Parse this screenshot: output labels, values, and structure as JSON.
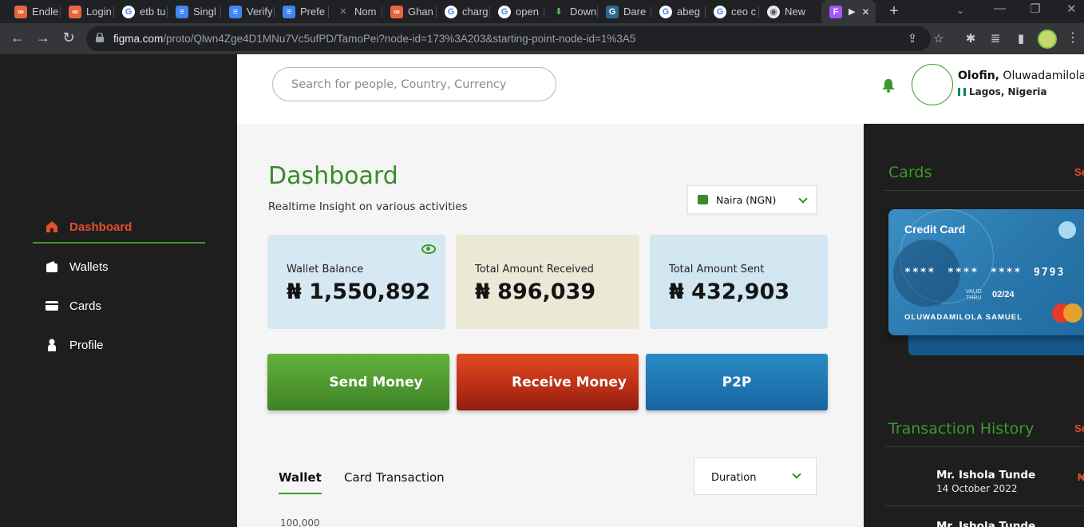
{
  "browser": {
    "tabs": [
      {
        "label": "Endle",
        "icon": "figma-logo-icon",
        "color": "#e8643a"
      },
      {
        "label": "Login",
        "icon": "figma-logo-icon",
        "color": "#e8643a"
      },
      {
        "label": "etb tu",
        "icon": "google-icon",
        "color": "#4285f4"
      },
      {
        "label": "Singl",
        "icon": "docs-icon",
        "color": "#4285f4"
      },
      {
        "label": "Verify",
        "icon": "docs-icon",
        "color": "#4285f4"
      },
      {
        "label": "Prefe",
        "icon": "docs-icon",
        "color": "#4285f4"
      },
      {
        "label": "Nom",
        "icon": "x-icon",
        "color": "#888888"
      },
      {
        "label": "Ghan",
        "icon": "figma-logo-icon",
        "color": "#e8643a"
      },
      {
        "label": "charg",
        "icon": "google-icon",
        "color": "#4285f4"
      },
      {
        "label": "open",
        "icon": "google-icon",
        "color": "#4285f4"
      },
      {
        "label": "Down",
        "icon": "download-icon",
        "color": "#5cb85c"
      },
      {
        "label": "Dare",
        "icon": "grammarly-icon",
        "color": "#2d6a8f"
      },
      {
        "label": "abeg",
        "icon": "google-icon",
        "color": "#4285f4"
      },
      {
        "label": "ceo c",
        "icon": "google-icon",
        "color": "#4285f4"
      },
      {
        "label": "New",
        "icon": "chrome-icon",
        "color": "#9aa0a6"
      }
    ],
    "url_host": "figma.com",
    "url_path": "/proto/Qlwn4Zge4D1MNu7Vc5ufPD/TamoPei?node-id=173%3A203&starting-point-node-id=1%3A5"
  },
  "sidebar": {
    "items": [
      {
        "label": "Dashboard",
        "icon": "home-icon"
      },
      {
        "label": "Wallets",
        "icon": "wallet-icon"
      },
      {
        "label": "Cards",
        "icon": "card-icon"
      },
      {
        "label": "Profile",
        "icon": "person-icon"
      }
    ]
  },
  "header": {
    "search_placeholder": "Search for people, Country, Currency",
    "user_last": "Olofin,",
    "user_first": " Oluwadamilola S",
    "location": "Lagos, Nigeria"
  },
  "main": {
    "title": "Dashboard",
    "subtitle": "Realtime Insight on various activities",
    "currency": "Naira (NGN)",
    "stats": [
      {
        "label": "Wallet Balance",
        "value": "₦ 1,550,892"
      },
      {
        "label": "Total Amount Received",
        "value": "₦ 896,039"
      },
      {
        "label": "Total Amount Sent",
        "value": "₦ 432,903"
      }
    ],
    "actions": {
      "send": "Send Money",
      "receive": "Receive Money",
      "p2p": "P2P"
    },
    "tabs": {
      "wallet": "Wallet",
      "card": "Card Transaction"
    },
    "duration": "Duration",
    "y_tick": "100,000"
  },
  "right": {
    "cards_title": "Cards",
    "see_all": "Se",
    "card": {
      "type": "Credit Card",
      "num": [
        "****",
        "****",
        "****",
        "9793"
      ],
      "valid_label_1": "VALID",
      "valid_label_2": "THRU",
      "expiry": "02/24",
      "holder": "OLUWADAMILOLA SAMUEL"
    },
    "history_title": "Transaction History",
    "transactions": [
      {
        "name": "Mr. Ishola Tunde",
        "date": "14 October 2022",
        "amount": "₦"
      },
      {
        "name": "Mr. Ishola Tunde",
        "date": "",
        "amount": ""
      }
    ]
  }
}
